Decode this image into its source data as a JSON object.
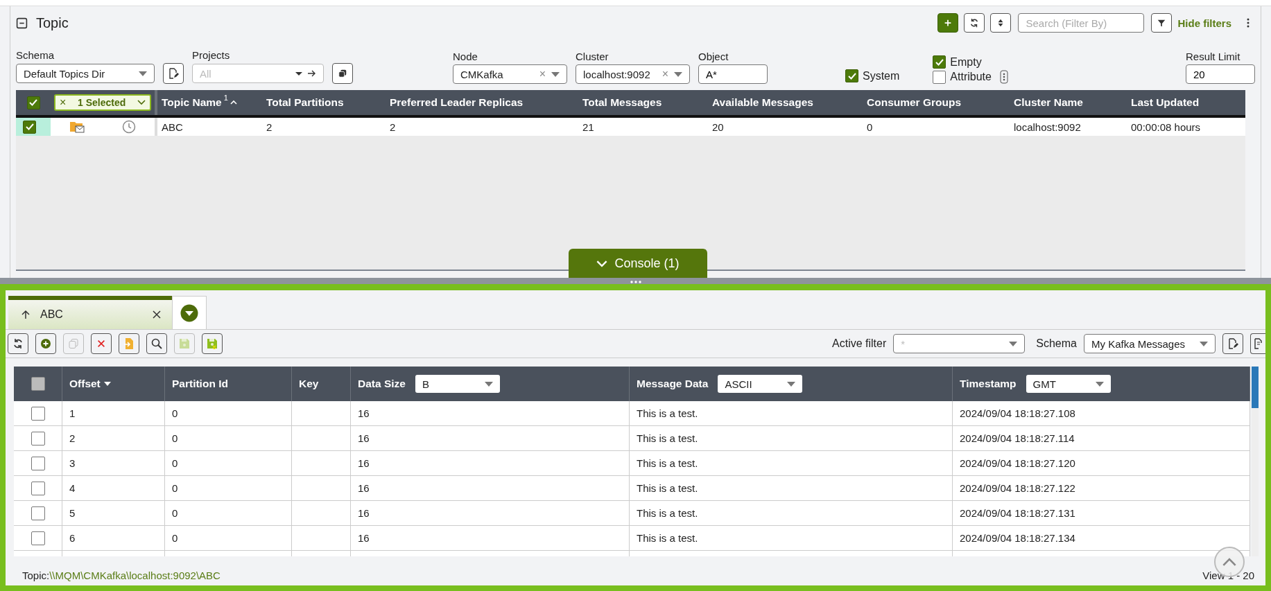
{
  "panel": {
    "title": "Topic",
    "search_placeholder": "Search (Filter By)",
    "hide_filters": "Hide filters"
  },
  "filters": {
    "schema": {
      "label": "Schema",
      "value": "Default Topics Dir"
    },
    "projects": {
      "label": "Projects",
      "placeholder": "All"
    },
    "node": {
      "label": "Node",
      "value": "CMKafka",
      "clear": "×"
    },
    "cluster": {
      "label": "Cluster",
      "value": "localhost:9092",
      "clear": "×"
    },
    "object": {
      "label": "Object",
      "value": "A*"
    },
    "system": {
      "label": "System",
      "checked": true
    },
    "empty": {
      "label": "Empty",
      "checked": true
    },
    "attribute": {
      "label": "Attribute",
      "checked": false
    },
    "result_limit": {
      "label": "Result Limit",
      "value": "20"
    }
  },
  "topics_table": {
    "all_checked": true,
    "selection_clear": "×",
    "selection_badge": "1 Selected",
    "sort_index": "1",
    "columns": [
      "Topic Name",
      "Total Partitions",
      "Preferred Leader Replicas",
      "Total Messages",
      "Available Messages",
      "Consumer Groups",
      "Cluster Name",
      "Last Updated"
    ],
    "rows": [
      {
        "checked": true,
        "cells": [
          "ABC",
          "2",
          "2",
          "21",
          "20",
          "0",
          "localhost:9092",
          "00:00:08 hours"
        ]
      }
    ]
  },
  "console_tab": {
    "label": "Console (1)"
  },
  "console": {
    "tabs": [
      {
        "label": "ABC",
        "selected": true
      }
    ],
    "active_filter": {
      "label": "Active filter",
      "placeholder": "*"
    },
    "schema": {
      "label": "Schema",
      "value": "My Kafka Messages"
    },
    "table": {
      "all_checked": false,
      "columns": [
        {
          "label": "Offset",
          "kind": "sort"
        },
        {
          "label": "Partition Id",
          "kind": "plain"
        },
        {
          "label": "Key",
          "kind": "plain"
        },
        {
          "label": "Data Size",
          "kind": "select",
          "value": "B"
        },
        {
          "label": "Message Data",
          "kind": "select",
          "value": "ASCII"
        },
        {
          "label": "Timestamp",
          "kind": "select",
          "value": "GMT"
        }
      ],
      "rows": [
        {
          "checked": false,
          "cells": [
            "1",
            "0",
            "",
            "16",
            "This is a test.",
            "2024/09/04 18:18:27.108"
          ]
        },
        {
          "checked": false,
          "cells": [
            "2",
            "0",
            "",
            "16",
            "This is a test.",
            "2024/09/04 18:18:27.114"
          ]
        },
        {
          "checked": false,
          "cells": [
            "3",
            "0",
            "",
            "16",
            "This is a test.",
            "2024/09/04 18:18:27.120"
          ]
        },
        {
          "checked": false,
          "cells": [
            "4",
            "0",
            "",
            "16",
            "This is a test.",
            "2024/09/04 18:18:27.122"
          ]
        },
        {
          "checked": false,
          "cells": [
            "5",
            "0",
            "",
            "16",
            "This is a test.",
            "2024/09/04 18:18:27.131"
          ]
        },
        {
          "checked": false,
          "cells": [
            "6",
            "0",
            "",
            "16",
            "This is a test.",
            "2024/09/04 18:18:27.134"
          ]
        }
      ]
    },
    "status": {
      "prefix": "Topic:",
      "path": "\\\\MQM\\CMKafka\\localhost:9092\\ABC",
      "view": "View 1 - 20"
    }
  }
}
